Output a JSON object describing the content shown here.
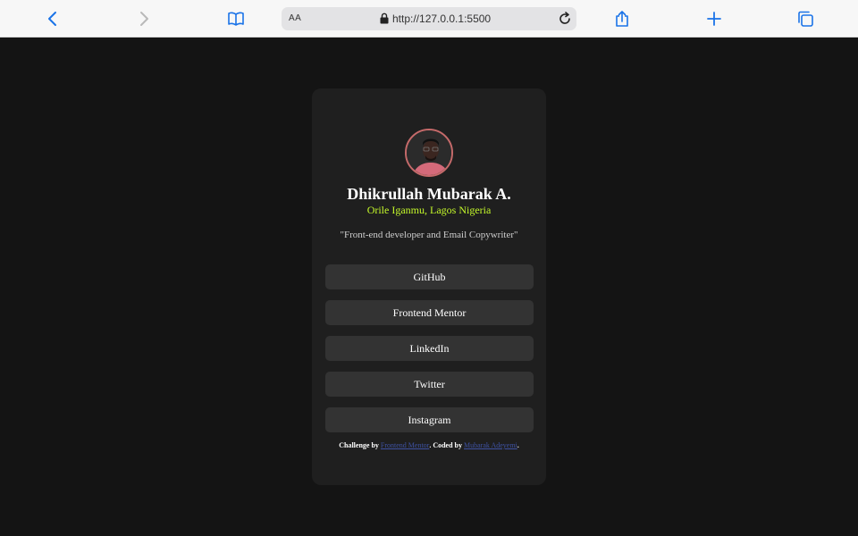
{
  "browser": {
    "text_size_label": "AA",
    "url": "http://127.0.0.1:5500",
    "icons": [
      "chevron-left-icon",
      "chevron-right-icon",
      "book-icon",
      "lock-icon",
      "reload-icon",
      "share-icon",
      "plus-icon",
      "tabs-icon"
    ],
    "accent": "#1a73e8"
  },
  "profile": {
    "name": "Dhikrullah Mubarak A.",
    "location": "Orile Iganmu, Lagos Nigeria",
    "bio": "\"Front-end developer and Email Copywriter\"",
    "avatar_border_color": "#c56a6a"
  },
  "links": [
    {
      "label": "GitHub"
    },
    {
      "label": "Frontend Mentor"
    },
    {
      "label": "LinkedIn"
    },
    {
      "label": "Twitter"
    },
    {
      "label": "Instagram"
    }
  ],
  "attribution": {
    "prefix": "Challenge by ",
    "challenge_link": "Frontend Mentor",
    "middle": ". Coded by ",
    "author_link": "Mubarak Adeyemi",
    "suffix": "."
  },
  "colors": {
    "page_bg": "#141414",
    "card_bg": "#1f1f1f",
    "button_bg": "#333333",
    "location_green": "#c4f82a"
  }
}
